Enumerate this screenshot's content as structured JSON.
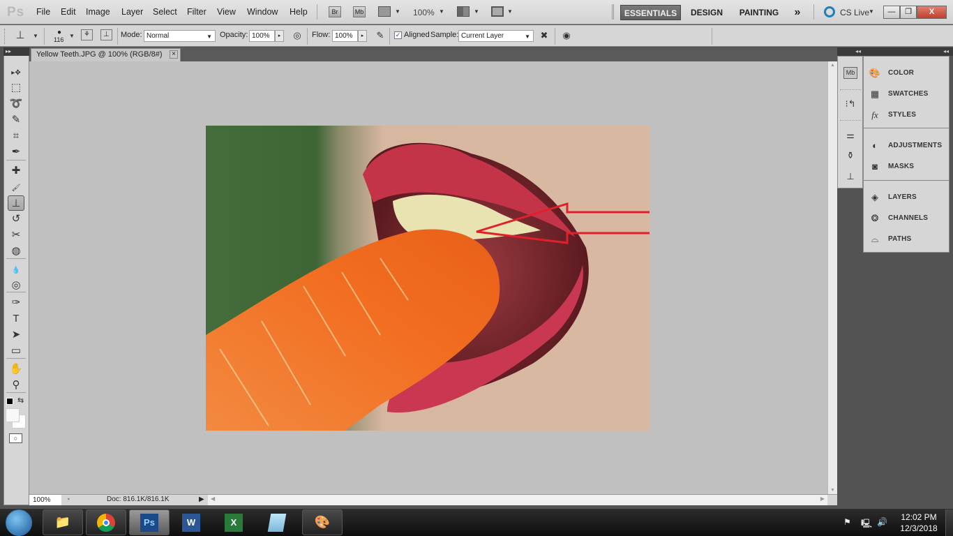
{
  "app": {
    "logo": "Ps",
    "menu": [
      "File",
      "Edit",
      "Image",
      "Layer",
      "Select",
      "Filter",
      "View",
      "Window",
      "Help"
    ],
    "appbar": {
      "bridge": "Br",
      "mini_bridge": "Mb",
      "zoom": "100%"
    },
    "workspaces": [
      "ESSENTIALS",
      "DESIGN",
      "PAINTING"
    ],
    "more_workspaces": "»",
    "cs_live": "CS Live",
    "window_controls": {
      "minimize": "—",
      "restore": "❐",
      "close": "X"
    }
  },
  "options": {
    "brush_size": "116",
    "mode_label": "Mode:",
    "mode_value": "Normal",
    "opacity_label": "Opacity:",
    "opacity_value": "100%",
    "flow_label": "Flow:",
    "flow_value": "100%",
    "aligned_label": "Aligned",
    "aligned_checked": true,
    "sample_label": "Sample:",
    "sample_value": "Current Layer"
  },
  "document": {
    "tab_title": "Yellow Teeth.JPG @ 100% (RGB/8#)",
    "close_glyph": "×",
    "status_zoom": "100%",
    "status_doc": "Doc: 816.1K/816.1K"
  },
  "toolbox": {
    "tools": [
      {
        "name": "move-tool",
        "glyph": "▸✥"
      },
      {
        "name": "marquee-tool",
        "glyph": "⬚"
      },
      {
        "name": "lasso-tool",
        "glyph": "➰"
      },
      {
        "name": "quick-selection-tool",
        "glyph": "✎"
      },
      {
        "name": "crop-tool",
        "glyph": "⌗"
      },
      {
        "name": "eyedropper-tool",
        "glyph": "✒"
      },
      {
        "name": "healing-brush-tool",
        "glyph": "✚"
      },
      {
        "name": "brush-tool",
        "glyph": "🖌"
      },
      {
        "name": "clone-stamp-tool",
        "glyph": "⊥",
        "active": true
      },
      {
        "name": "history-brush-tool",
        "glyph": "↺"
      },
      {
        "name": "eraser-tool",
        "glyph": "✂"
      },
      {
        "name": "paint-bucket-tool",
        "glyph": "◍"
      },
      {
        "name": "blur-tool",
        "glyph": "💧"
      },
      {
        "name": "dodge-tool",
        "glyph": "◎"
      },
      {
        "name": "pen-tool",
        "glyph": "✑"
      },
      {
        "name": "type-tool",
        "glyph": "T"
      },
      {
        "name": "path-selection-tool",
        "glyph": "➤"
      },
      {
        "name": "shape-tool",
        "glyph": "▭"
      },
      {
        "name": "hand-tool",
        "glyph": "✋"
      },
      {
        "name": "zoom-tool",
        "glyph": "⚲"
      }
    ],
    "foreground_color": "#000000",
    "background_color": "#ffffff"
  },
  "panels": {
    "group1": [
      "COLOR",
      "SWATCHES",
      "STYLES"
    ],
    "group2": [
      "ADJUSTMENTS",
      "MASKS"
    ],
    "group3": [
      "LAYERS",
      "CHANNELS",
      "PATHS"
    ]
  },
  "taskbar": {
    "apps": [
      "Windows Explorer",
      "Google Chrome",
      "Photoshop",
      "Word",
      "Excel",
      "Notepad",
      "Paint"
    ],
    "time": "12:02 PM",
    "date": "12/3/2018"
  },
  "colors": {
    "accent_red": "#e0202a",
    "photo_green": "#3f6a35",
    "carrot": "#f07a2a",
    "lip": "#c43346"
  }
}
